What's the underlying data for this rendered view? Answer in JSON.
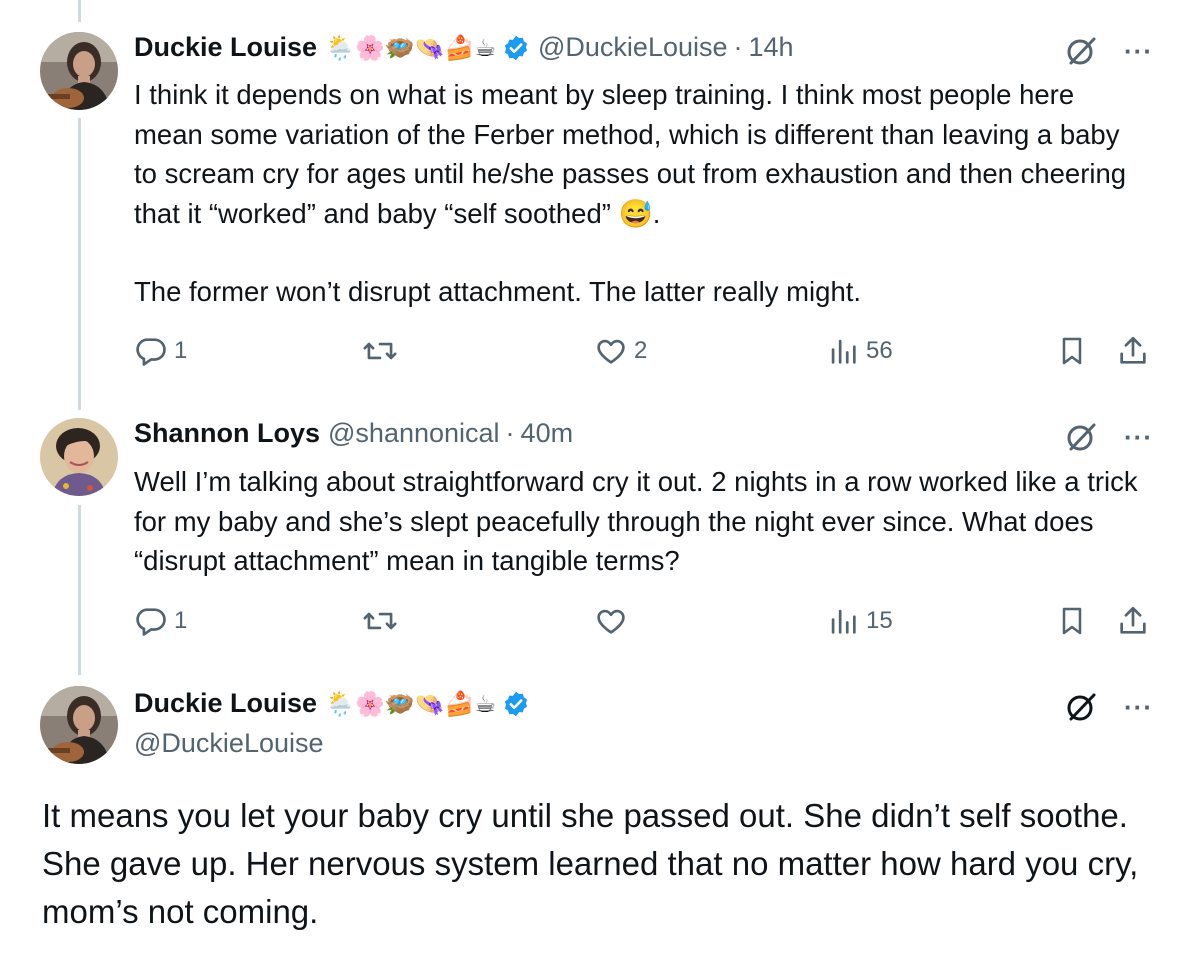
{
  "tweets": [
    {
      "name": "Duckie Louise",
      "emojis": "🌦️🌸🪺👒🍰☕",
      "handle": "@DuckieLouise",
      "time": "14h",
      "paragraphs": [
        "I think it depends on what is meant by sleep training. I think most people here mean some variation of the Ferber method, which is different than leaving a baby to scream cry for ages until he/she passes out from exhaustion and then cheering that it “worked” and baby “self soothed” 😅.",
        "The former won’t disrupt attachment. The latter really might."
      ],
      "replies": "1",
      "retweets": "",
      "likes": "2",
      "views": "56"
    },
    {
      "name": "Shannon Loys",
      "handle": "@shannonical",
      "time": "40m",
      "paragraphs": [
        "Well I’m talking about straightforward cry it out. 2 nights in a row worked like a trick for my baby and she’s slept peacefully through the night ever since. What does “disrupt attachment” mean in tangible terms?"
      ],
      "replies": "1",
      "retweets": "",
      "likes": "",
      "views": "15"
    }
  ],
  "focused": {
    "name": "Duckie Louise",
    "emojis": "🌦️🌸🪺👒🍰☕",
    "handle": "@DuckieLouise",
    "text": "It means you let your baby cry until she passed out. She didn’t self soothe. She gave up. Her nervous system learned that no matter how hard you cry, mom’s not coming."
  },
  "more_label": "···",
  "dot": "·",
  "colors": {
    "verified": "#1d9bf0",
    "muted": "#536471",
    "thread_line": "#cfd9de"
  }
}
